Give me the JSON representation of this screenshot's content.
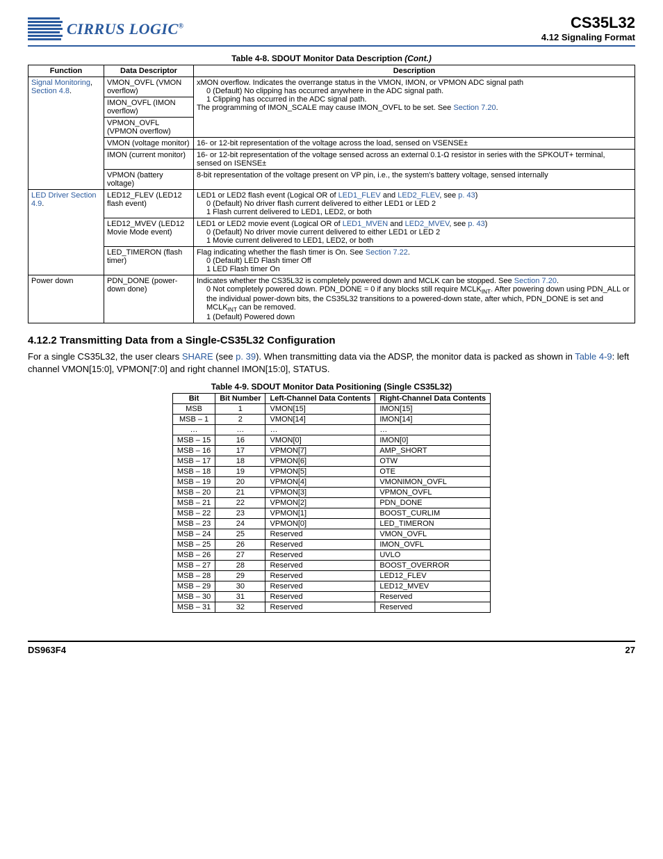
{
  "header": {
    "brand": "CIRRUS LOGIC",
    "reg": "®",
    "docTitle": "CS35L32",
    "sectionTitle": "4.12 Signaling Format"
  },
  "table48": {
    "caption": "Table 4-8.  SDOUT Monitor Data Description",
    "cont": " (Cont.)",
    "headers": [
      "Function",
      "Data Descriptor",
      "Description"
    ],
    "groups": [
      {
        "funcLinks": [
          "Signal Monitoring",
          "Section 4.8"
        ],
        "funcSep": ", ",
        "funcTail": ".",
        "rows": [
          {
            "rowspan": 3,
            "dd": "VMON_OVFL (VMON overflow)",
            "desc_main": "xMON overflow. Indicates the overrange status in the VMON, IMON, or VPMON ADC signal path",
            "desc_lines": [
              "0 (Default) No clipping has occurred anywhere in the ADC signal path.",
              "1 Clipping has occurred in the ADC signal path."
            ],
            "desc_tail_pre": "The programming of IMON_SCALE may cause IMON_OVFL to be set. See ",
            "desc_tail_link": "Section 7.20",
            "desc_tail_post": "."
          },
          {
            "dd": "IMON_OVFL (IMON overflow)"
          },
          {
            "dd": "VPMON_OVFL (VPMON overflow)"
          },
          {
            "dd": "VMON (voltage monitor)",
            "desc_plain": "16- or 12-bit representation of the voltage across the load, sensed on VSENSE±"
          },
          {
            "dd": "IMON (current monitor)",
            "desc_plain": "16- or 12-bit representation of the voltage sensed across an external 0.1-Ω resistor in series with the SPKOUT+ terminal, sensed on ISENSE±"
          },
          {
            "dd": "VPMON (battery voltage)",
            "desc_plain": "8-bit representation of the voltage present on VP pin, i.e., the system's battery voltage, sensed internally"
          }
        ]
      },
      {
        "funcLinks": [
          "LED Driver",
          "Section 4.9"
        ],
        "funcSep": " ",
        "funcTail": ".",
        "rows": [
          {
            "dd": "LED12_FLEV (LED12 flash event)",
            "desc_pre": "LED1 or LED2 flash event (Logical OR of ",
            "desc_link1": "LED1_FLEV",
            "desc_mid": " and ",
            "desc_link2": "LED2_FLEV",
            "desc_post": ", see ",
            "desc_page": "p. 43",
            "desc_close": ")",
            "desc_lines": [
              "0 (Default) No driver flash current delivered to either LED1 or LED 2",
              "1 Flash current delivered to LED1, LED2, or both"
            ]
          },
          {
            "dd": "LED12_MVEV (LED12 Movie Mode event)",
            "desc_pre": "LED1 or LED2 movie event (Logical OR of ",
            "desc_link1": "LED1_MVEN",
            "desc_mid": " and ",
            "desc_link2": "LED2_MVEV",
            "desc_post": ", see ",
            "desc_page": "p. 43",
            "desc_close": ")",
            "desc_lines": [
              "0 (Default) No driver movie current delivered to either LED1 or LED 2",
              "1 Movie current delivered to LED1, LED2, or both"
            ]
          },
          {
            "dd": "LED_TIMERON (flash timer)",
            "desc_plain_pre": "Flag indicating whether the flash timer is On. See ",
            "desc_plain_link": "Section 7.22",
            "desc_plain_post": ".",
            "desc_lines": [
              "0 (Default) LED Flash timer Off",
              "1 LED Flash timer On"
            ]
          }
        ]
      },
      {
        "funcPlain": "Power down",
        "rows": [
          {
            "dd": "PDN_DONE (power-down done)",
            "pdn_pre": "Indicates whether the CS35L32 is completely powered down and MCLK can be stopped. See ",
            "pdn_link": "Section 7.20",
            "pdn_post": ".",
            "pdn_line0a": "0 Not completely powered down. PDN_DONE = 0 if any blocks still require MCLK",
            "pdn_line0b": ". After powering down using PDN_ALL or the individual power-down bits, the CS35L32 transitions to a powered-down state, after which, PDN_DONE is set and MCLK",
            "pdn_line0c": " can be removed.",
            "pdn_sub": "INT",
            "pdn_line1": "1 (Default) Powered down"
          }
        ]
      }
    ]
  },
  "sec412_2": {
    "heading": "4.12.2   Transmitting Data from a Single-CS35L32 Configuration",
    "body_pre": "For a single CS35L32, the user clears ",
    "body_share": "SHARE",
    "body_mid1": " (see ",
    "body_p39": "p. 39",
    "body_mid2": "). When transmitting data via the ADSP, the monitor data is packed as shown in ",
    "body_t49": "Table 4-9",
    "body_post": ": left channel VMON[15:0], VPMON[7:0] and right channel IMON[15:0], STATUS."
  },
  "table49": {
    "caption_pre": "Table 4-9.  SDOUT Monitor Data Positioning (Single CS35L32",
    "caption_post": ")",
    "headers": [
      "Bit",
      "Bit Number",
      "Left-Channel Data Contents",
      "Right-Channel Data Contents"
    ],
    "rows": [
      [
        "MSB",
        "1",
        "VMON[15]",
        "IMON[15]"
      ],
      [
        "MSB – 1",
        "2",
        "VMON[14]",
        "IMON[14]"
      ],
      [
        "…",
        "…",
        "…",
        "…"
      ],
      [
        "MSB – 15",
        "16",
        "VMON[0]",
        "IMON[0]"
      ],
      [
        "MSB – 16",
        "17",
        "VPMON[7]",
        "AMP_SHORT"
      ],
      [
        "MSB – 17",
        "18",
        "VPMON[6]",
        "OTW"
      ],
      [
        "MSB – 18",
        "19",
        "VPMON[5]",
        "OTE"
      ],
      [
        "MSB – 19",
        "20",
        "VPMON[4]",
        "VMONIMON_OVFL"
      ],
      [
        "MSB – 20",
        "21",
        "VPMON[3]",
        "VPMON_OVFL"
      ],
      [
        "MSB – 21",
        "22",
        "VPMON[2]",
        "PDN_DONE"
      ],
      [
        "MSB – 22",
        "23",
        "VPMON[1]",
        "BOOST_CURLIM"
      ],
      [
        "MSB – 23",
        "24",
        "VPMON[0]",
        "LED_TIMERON"
      ],
      [
        "MSB – 24",
        "25",
        "Reserved",
        "VMON_OVFL"
      ],
      [
        "MSB – 25",
        "26",
        "Reserved",
        "IMON_OVFL"
      ],
      [
        "MSB – 26",
        "27",
        "Reserved",
        "UVLO"
      ],
      [
        "MSB – 27",
        "28",
        "Reserved",
        "BOOST_OVERROR"
      ],
      [
        "MSB – 28",
        "29",
        "Reserved",
        "LED12_FLEV"
      ],
      [
        "MSB – 29",
        "30",
        "Reserved",
        "LED12_MVEV"
      ],
      [
        "MSB – 30",
        "31",
        "Reserved",
        "Reserved"
      ],
      [
        "MSB – 31",
        "32",
        "Reserved",
        "Reserved"
      ]
    ]
  },
  "footer": {
    "left": "DS963F4",
    "right": "27"
  }
}
